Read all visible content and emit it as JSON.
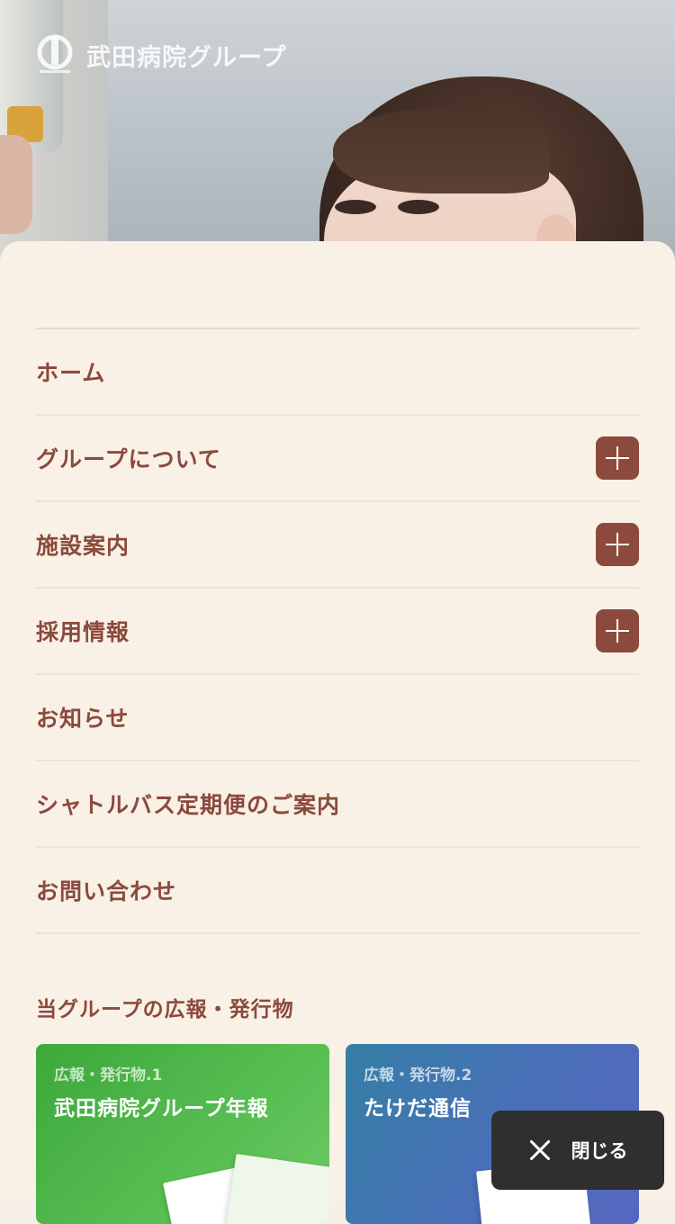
{
  "header": {
    "logo_text": "武田病院グループ",
    "logo_icon": "takeda-hospital-logo-icon"
  },
  "menu": {
    "items": [
      {
        "label": "ホーム",
        "expandable": false
      },
      {
        "label": "グループについて",
        "expandable": true
      },
      {
        "label": "施設案内",
        "expandable": true
      },
      {
        "label": "採用情報",
        "expandable": true
      },
      {
        "label": "お知らせ",
        "expandable": false
      },
      {
        "label": "シャトルバス定期便のご案内",
        "expandable": false
      },
      {
        "label": "お問い合わせ",
        "expandable": false
      }
    ],
    "expand_icon": "plus-icon"
  },
  "publications": {
    "heading": "当グループの広報・発行物",
    "cards": [
      {
        "number": "広報・発行物.1",
        "title": "武田病院グループ年報",
        "color": "#4bb446"
      },
      {
        "number": "広報・発行物.2",
        "title": "たけだ通信",
        "color": "#4a72b6"
      }
    ]
  },
  "close_button": {
    "label": "閉じる",
    "icon": "close-icon"
  },
  "colors": {
    "sheet_bg": "#f9f0e6",
    "accent": "#8b4a3c",
    "close_bg": "#2f2f2f"
  }
}
